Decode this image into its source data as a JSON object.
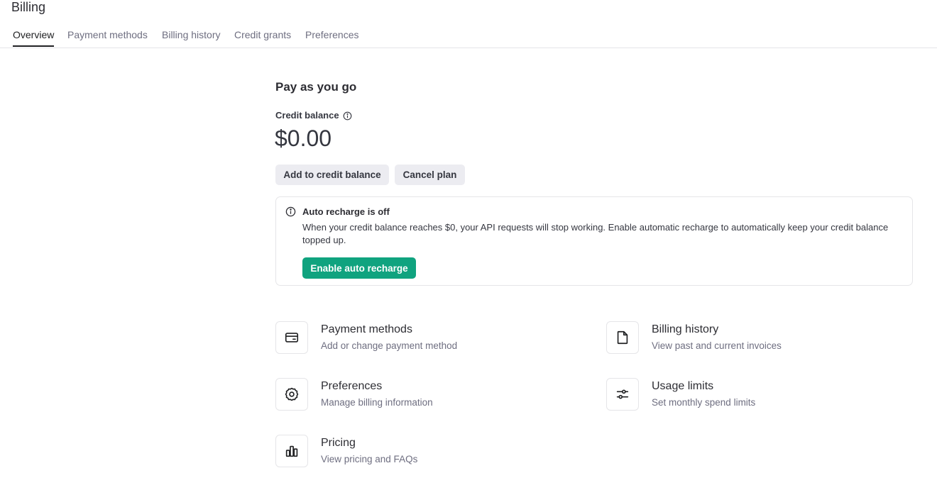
{
  "page": {
    "title": "Billing"
  },
  "tabs": [
    {
      "label": "Overview",
      "active": true
    },
    {
      "label": "Payment methods",
      "active": false
    },
    {
      "label": "Billing history",
      "active": false
    },
    {
      "label": "Credit grants",
      "active": false
    },
    {
      "label": "Preferences",
      "active": false
    }
  ],
  "plan": {
    "title": "Pay as you go",
    "credit_label": "Credit balance",
    "credit_info_icon": "info-icon",
    "balance": "$0.00",
    "add_credit_label": "Add to credit balance",
    "cancel_plan_label": "Cancel plan"
  },
  "notice": {
    "icon": "info-icon",
    "title": "Auto recharge is off",
    "text": "When your credit balance reaches $0, your API requests will stop working. Enable automatic recharge to automatically keep your credit balance topped up.",
    "button_label": "Enable auto recharge",
    "button_color": "#10a37f"
  },
  "cards": [
    {
      "icon": "credit-card-icon",
      "title": "Payment methods",
      "subtitle": "Add or change payment method"
    },
    {
      "icon": "document-icon",
      "title": "Billing history",
      "subtitle": "View past and current invoices"
    },
    {
      "icon": "gear-icon",
      "title": "Preferences",
      "subtitle": "Manage billing information"
    },
    {
      "icon": "sliders-icon",
      "title": "Usage limits",
      "subtitle": "Set monthly spend limits"
    },
    {
      "icon": "bar-chart-icon",
      "title": "Pricing",
      "subtitle": "View pricing and FAQs"
    }
  ]
}
